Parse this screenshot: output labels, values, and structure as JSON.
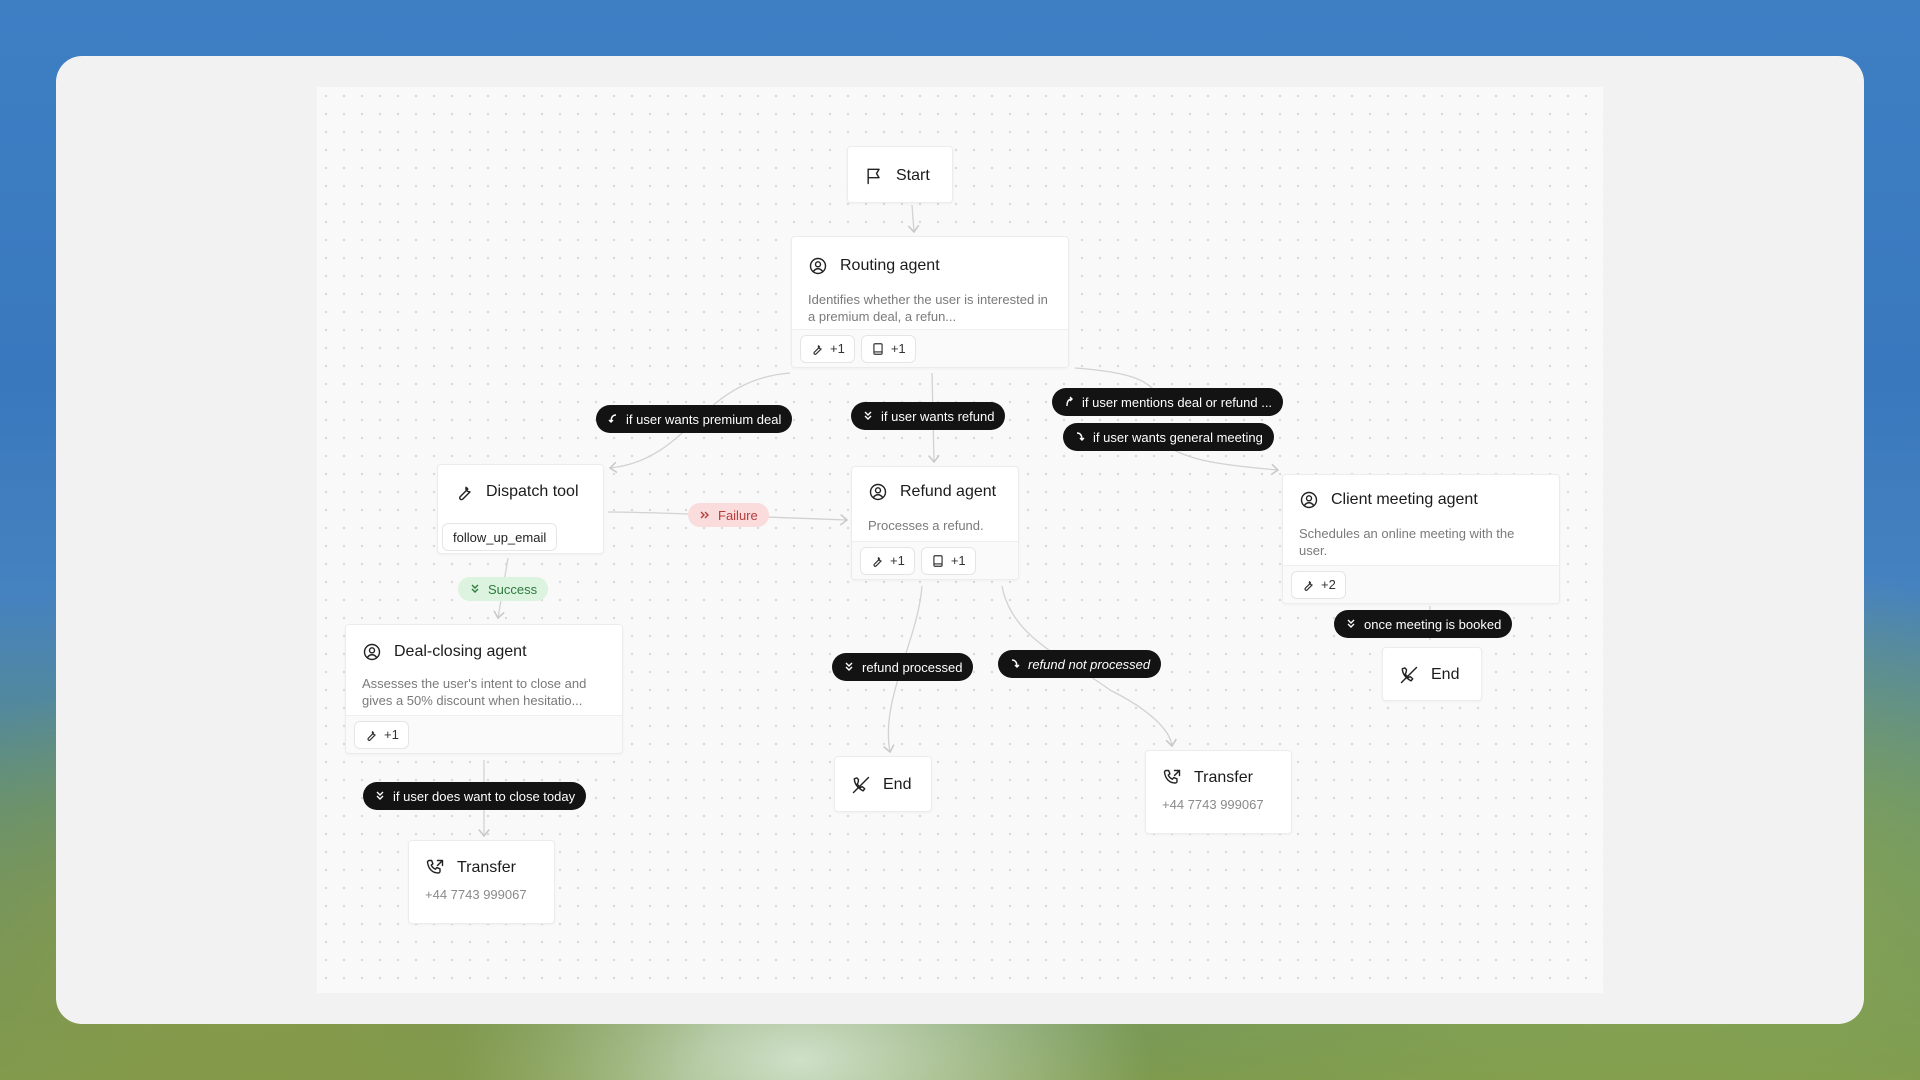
{
  "nodes": {
    "start": {
      "label": "Start"
    },
    "routing": {
      "title": "Routing agent",
      "description": "Identifies whether the user is interested in a premium deal, a refun...",
      "tools_count": "+1",
      "kb_count": "+1"
    },
    "dispatch": {
      "title": "Dispatch tool",
      "tool": "follow_up_email"
    },
    "refund": {
      "title": "Refund agent",
      "description": "Processes a refund.",
      "tools_count": "+1",
      "kb_count": "+1"
    },
    "client_meeting": {
      "title": "Client meeting agent",
      "description": "Schedules an online meeting with the user.",
      "tools_count": "+2"
    },
    "deal_closing": {
      "title": "Deal-closing agent",
      "description": "Assesses the user's intent to close and gives a 50% discount when hesitatio...",
      "tools_count": "+1"
    },
    "end_refund": {
      "label": "End"
    },
    "end_meeting": {
      "label": "End"
    },
    "transfer_refund": {
      "title": "Transfer",
      "phone": "+44 7743 999067"
    },
    "transfer_deal": {
      "title": "Transfer",
      "phone": "+44 7743 999067"
    }
  },
  "edges": {
    "premium_deal": "if user wants premium deal",
    "wants_refund": "if user wants refund",
    "mentions_deal_or_refund": "if user mentions deal or refund ...",
    "general_meeting": "if user wants general meeting",
    "failure": "Failure",
    "success": "Success",
    "refund_processed": "refund processed",
    "refund_not_processed": "refund not processed",
    "meeting_booked": "once meeting is booked",
    "close_today": "if user does want to close today"
  },
  "colors": {
    "edge_pill_bg": "#131313",
    "failure_bg": "#fbdcdc",
    "success_bg": "#dcf3df"
  }
}
